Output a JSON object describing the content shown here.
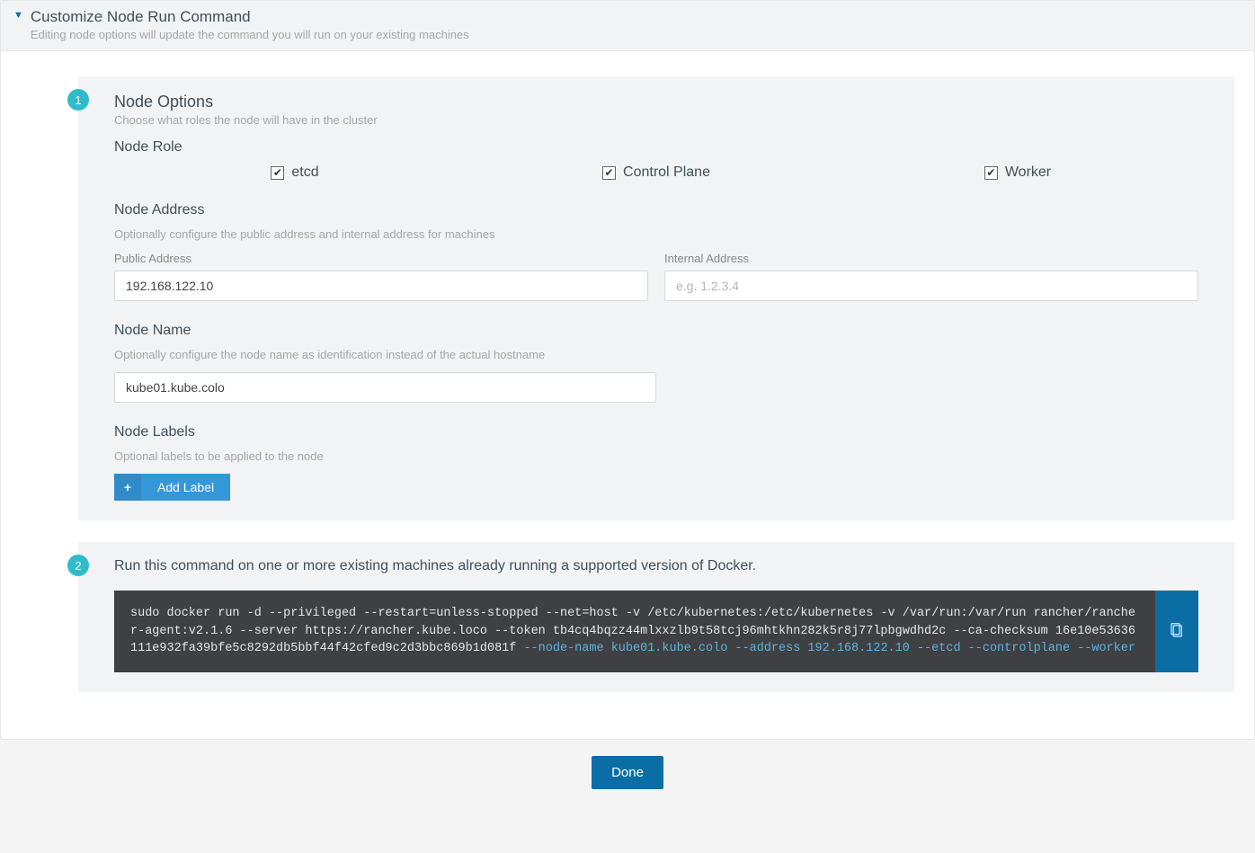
{
  "header": {
    "title": "Customize Node Run Command",
    "subtitle": "Editing node options will update the command you will run on your existing machines"
  },
  "step1": {
    "badge": "1",
    "title": "Node Options",
    "subtitle": "Choose what roles the node will have in the cluster",
    "role_heading": "Node Role",
    "roles": {
      "etcd": {
        "label": "etcd",
        "checked": true
      },
      "control_plane": {
        "label": "Control Plane",
        "checked": true
      },
      "worker": {
        "label": "Worker",
        "checked": true
      }
    },
    "address": {
      "heading": "Node Address",
      "help": "Optionally configure the public address and internal address for machines",
      "public_label": "Public Address",
      "public_value": "192.168.122.10",
      "internal_label": "Internal Address",
      "internal_placeholder": "e.g. 1.2.3.4",
      "internal_value": ""
    },
    "name": {
      "heading": "Node Name",
      "help": "Optionally configure the node name as identification instead of the actual hostname",
      "value": "kube01.kube.colo"
    },
    "labels": {
      "heading": "Node Labels",
      "help": "Optional labels to be applied to the node",
      "add_button": "Add Label"
    }
  },
  "step2": {
    "badge": "2",
    "title": "Run this command on one or more existing machines already running a supported version of Docker.",
    "command_prefix": "sudo docker run -d --privileged --restart=unless-stopped --net=host -v /etc/kubernetes:/etc/kubernetes -v /var/run:/var/run rancher/rancher-agent:v2.1.6 --server https://rancher.kube.loco --token tb4cq4bqzz44mlxxzlb9t58tcj96mhtkhn282k5r8j77lpbgwdhd2c --ca-checksum 16e10e53636111e932fa39bfe5c8292db5bbf44f42cfed9c2d3bbc869b1d081f",
    "command_args": " --node-name kube01.kube.colo --address 192.168.122.10 --etcd --controlplane --worker"
  },
  "footer": {
    "done": "Done"
  },
  "colors": {
    "accent": "#0a6ea5",
    "badge": "#30bbca",
    "code_bg": "#3f4043",
    "button_blue": "#3497da"
  }
}
